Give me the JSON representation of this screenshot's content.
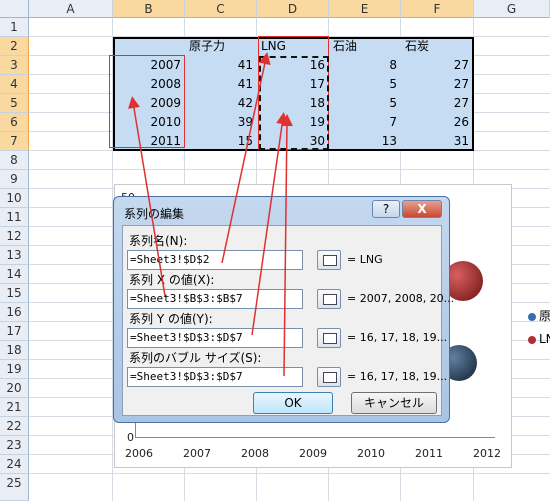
{
  "columns": [
    "A",
    "B",
    "C",
    "D",
    "E",
    "F",
    "G"
  ],
  "rows": [
    "1",
    "2",
    "3",
    "4",
    "5",
    "6",
    "7",
    "8",
    "9",
    "10",
    "11",
    "12",
    "13",
    "14",
    "15",
    "16",
    "17",
    "18",
    "19",
    "20",
    "21",
    "22",
    "23",
    "24",
    "25"
  ],
  "table": {
    "headers": [
      "原子力",
      "LNG",
      "石油",
      "石炭"
    ],
    "years": [
      "2007",
      "2008",
      "2009",
      "2010",
      "2011"
    ],
    "values": [
      [
        "41",
        "16",
        "8",
        "27"
      ],
      [
        "41",
        "17",
        "5",
        "27"
      ],
      [
        "42",
        "18",
        "5",
        "27"
      ],
      [
        "39",
        "19",
        "7",
        "26"
      ],
      [
        "15",
        "30",
        "13",
        "31"
      ]
    ]
  },
  "chart": {
    "y_top": "50",
    "y_bottom": "0",
    "x_ticks": [
      "2006",
      "2007",
      "2008",
      "2009",
      "2010",
      "2011",
      "2012"
    ],
    "legend": [
      "原",
      "LN"
    ],
    "legend_colors": [
      "#3a6cb0",
      "#b03030"
    ]
  },
  "dialog": {
    "title": "系列の編集",
    "help_label": "?",
    "close_label": "X",
    "name_label": "系列名(N):",
    "name_value": "=Sheet3!$D$2",
    "name_preview": "= LNG",
    "x_label": "系列 X の値(X):",
    "x_value": "=Sheet3!$B$3:$B$7",
    "x_preview": "= 2007, 2008, 20...",
    "y_label": "系列 Y の値(Y):",
    "y_value": "=Sheet3!$D$3:$D$7",
    "y_preview": "= 16, 17, 18, 19...",
    "size_label": "系列のバブル サイズ(S):",
    "size_value": "=Sheet3!$D$3:$D$7",
    "size_preview": "= 16, 17, 18, 19...",
    "ok_label": "OK",
    "cancel_label": "キャンセル"
  },
  "colors": {
    "selection": "#c5dcf3",
    "annotation": "#e03030",
    "header_selected": "#f9d99f"
  }
}
